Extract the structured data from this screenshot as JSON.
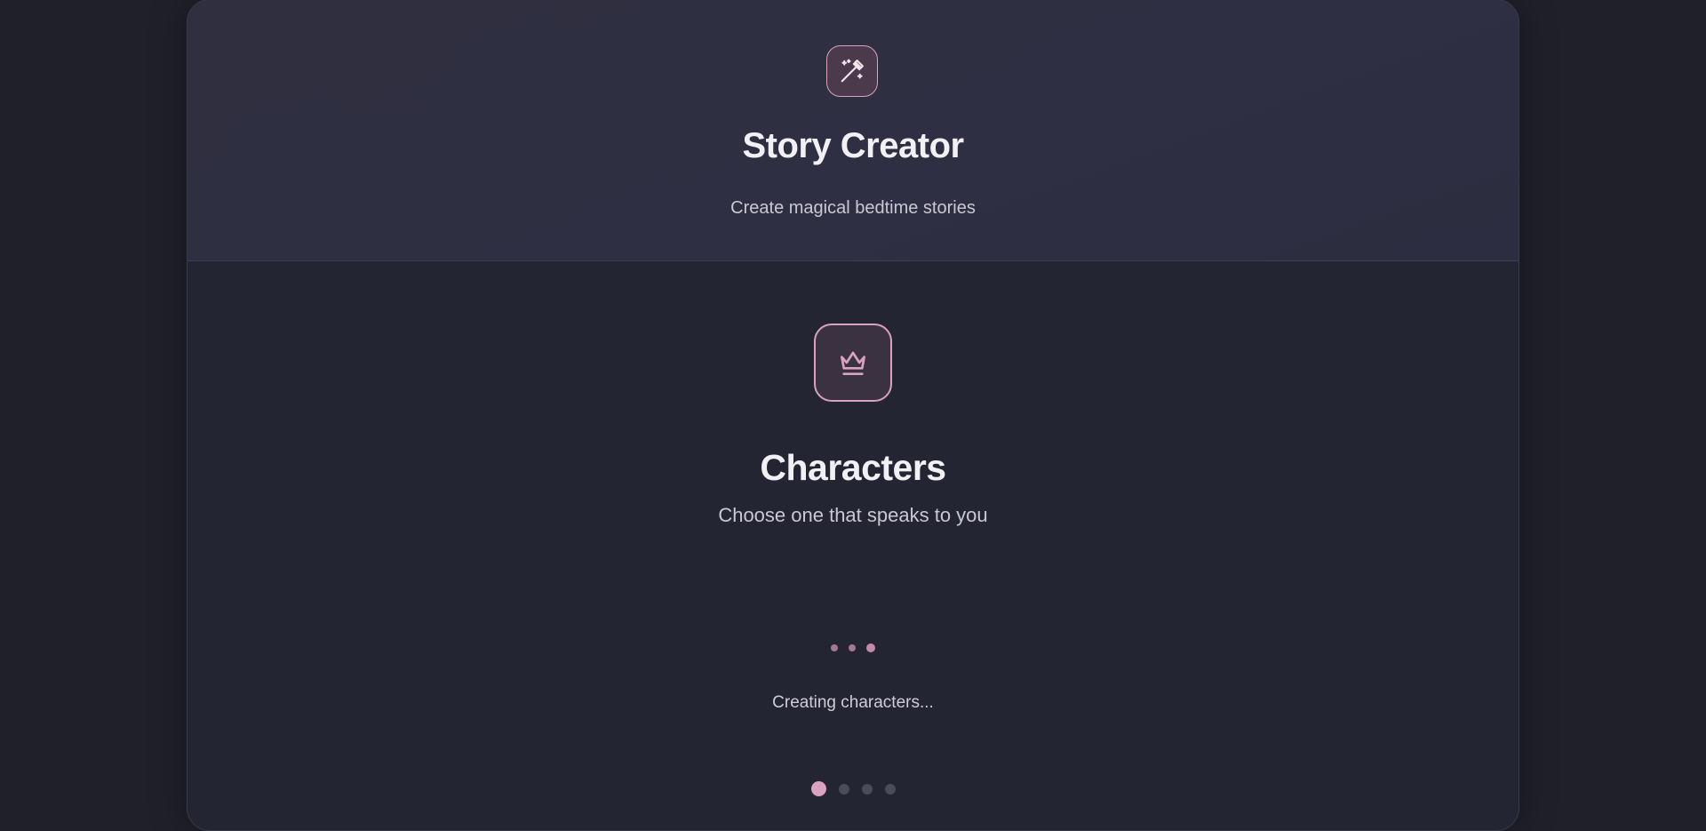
{
  "header": {
    "icon": "magic-wand-icon",
    "title": "Story Creator",
    "subtitle": "Create magical bedtime stories"
  },
  "section": {
    "icon": "crown-icon",
    "title": "Characters",
    "subtitle": "Choose one that speaks to you"
  },
  "loading": {
    "text": "Creating characters..."
  },
  "pager": {
    "total_steps": 4,
    "current_step": 1
  },
  "colors": {
    "accent": "#d9a2c0",
    "background": "#1f2029",
    "card": "#242532"
  }
}
